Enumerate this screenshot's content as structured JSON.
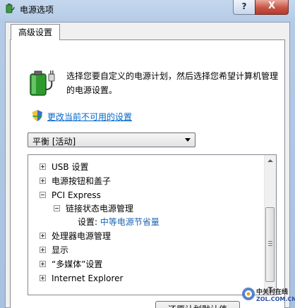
{
  "window": {
    "title": "电源选项",
    "help_label": "?",
    "close_label": "X"
  },
  "tab": {
    "label": "高级设置"
  },
  "description": {
    "line1": "选择您要自定义的电源计划，然后选择您希望计算机管理",
    "line2": "的电源设置。"
  },
  "link": {
    "label": "更改当前不可用的设置"
  },
  "plan_select": {
    "selected": "平衡 [活动]"
  },
  "tree": {
    "items": [
      {
        "label": "USB 设置",
        "state": "collapsed"
      },
      {
        "label": "电源按钮和盖子",
        "state": "collapsed"
      },
      {
        "label": "PCI Express",
        "state": "expanded"
      },
      {
        "label": "链接状态电源管理",
        "state": "expanded"
      },
      {
        "label": "设置:",
        "value": "中等电源节省量"
      },
      {
        "label": "处理器电源管理",
        "state": "collapsed"
      },
      {
        "label": "显示",
        "state": "collapsed"
      },
      {
        "label": "“多媒体”设置",
        "state": "collapsed"
      },
      {
        "label": "Internet Explorer",
        "state": "collapsed"
      }
    ]
  },
  "buttons": {
    "restore_defaults": "还原计划默认值"
  },
  "watermark": {
    "cn": "中关村在线",
    "en": "ZOL.COM.CN"
  },
  "colors": {
    "link": "#0066cc",
    "setting_value": "#1a64b4",
    "close_button": "#c75445"
  }
}
